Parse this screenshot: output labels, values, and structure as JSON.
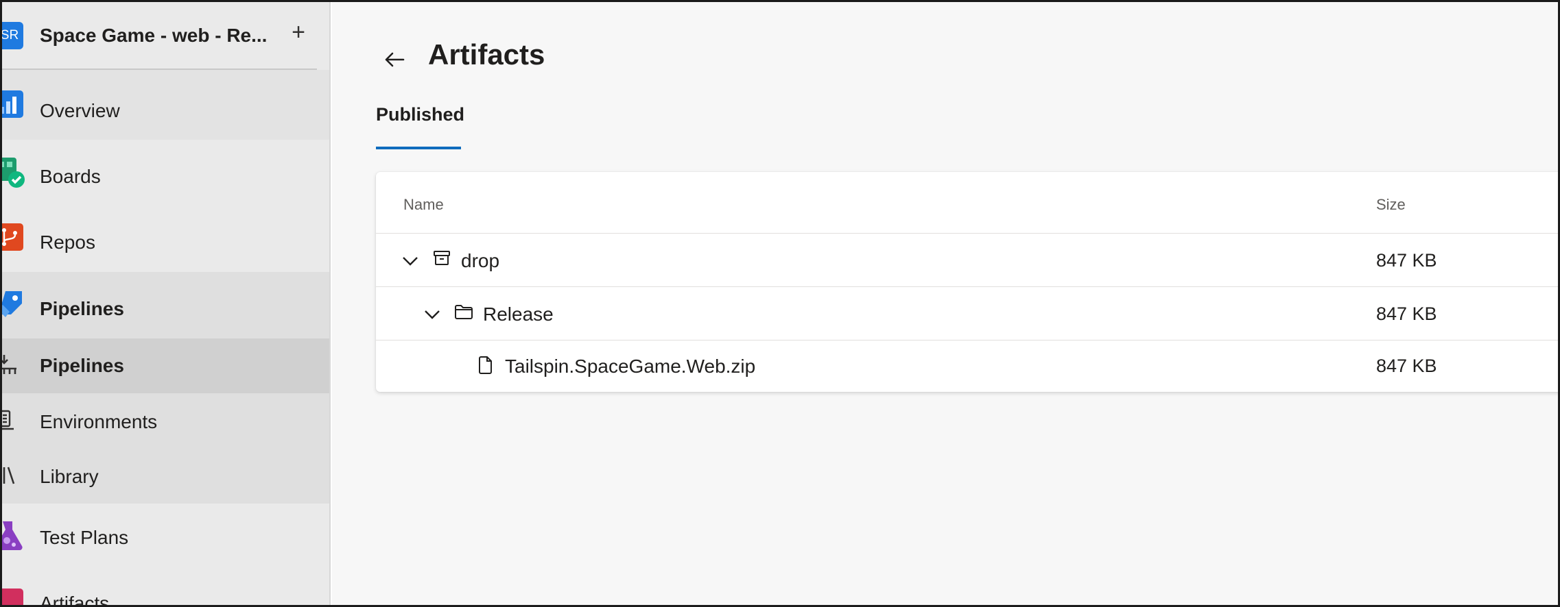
{
  "project": {
    "avatar_text": "SR",
    "name": "Space Game - web - Re...",
    "add_symbol": "+"
  },
  "sidebar": {
    "items": [
      {
        "label": "Overview",
        "icon": "overview-icon",
        "color": "#1f7ae0"
      },
      {
        "label": "Boards",
        "icon": "boards-icon",
        "color": "#0fb77f"
      },
      {
        "label": "Repos",
        "icon": "repos-icon",
        "color": "#e0481f"
      },
      {
        "label": "Pipelines",
        "icon": "pipelines-icon",
        "color": "#1f7ae0"
      },
      {
        "label": "Pipelines",
        "icon": "pipelines-sub-icon",
        "color": "#323130"
      },
      {
        "label": "Environments",
        "icon": "environments-icon",
        "color": "#323130"
      },
      {
        "label": "Library",
        "icon": "library-icon",
        "color": "#323130"
      },
      {
        "label": "Test Plans",
        "icon": "test-plans-icon",
        "color": "#8a3fc2"
      },
      {
        "label": "Artifacts",
        "icon": "artifacts-icon",
        "color": "#d12f5e"
      }
    ]
  },
  "main": {
    "title": "Artifacts",
    "back_icon": "back-arrow-icon",
    "tabs": [
      {
        "label": "Published",
        "selected": true
      }
    ],
    "table": {
      "columns": [
        "Name",
        "Size"
      ],
      "rows": [
        {
          "name": "drop",
          "size": "847 KB",
          "icon": "artifact-box-icon",
          "expanded": true
        },
        {
          "name": "Release",
          "size": "847 KB",
          "icon": "folder-icon",
          "expanded": true
        },
        {
          "name": "Tailspin.SpaceGame.Web.zip",
          "size": "847 KB",
          "icon": "file-icon"
        }
      ]
    }
  },
  "colors": {
    "accent": "#0f6cbd",
    "sidebar_bg": "#eaeaea",
    "selected_bg": "#d0d0d0"
  }
}
